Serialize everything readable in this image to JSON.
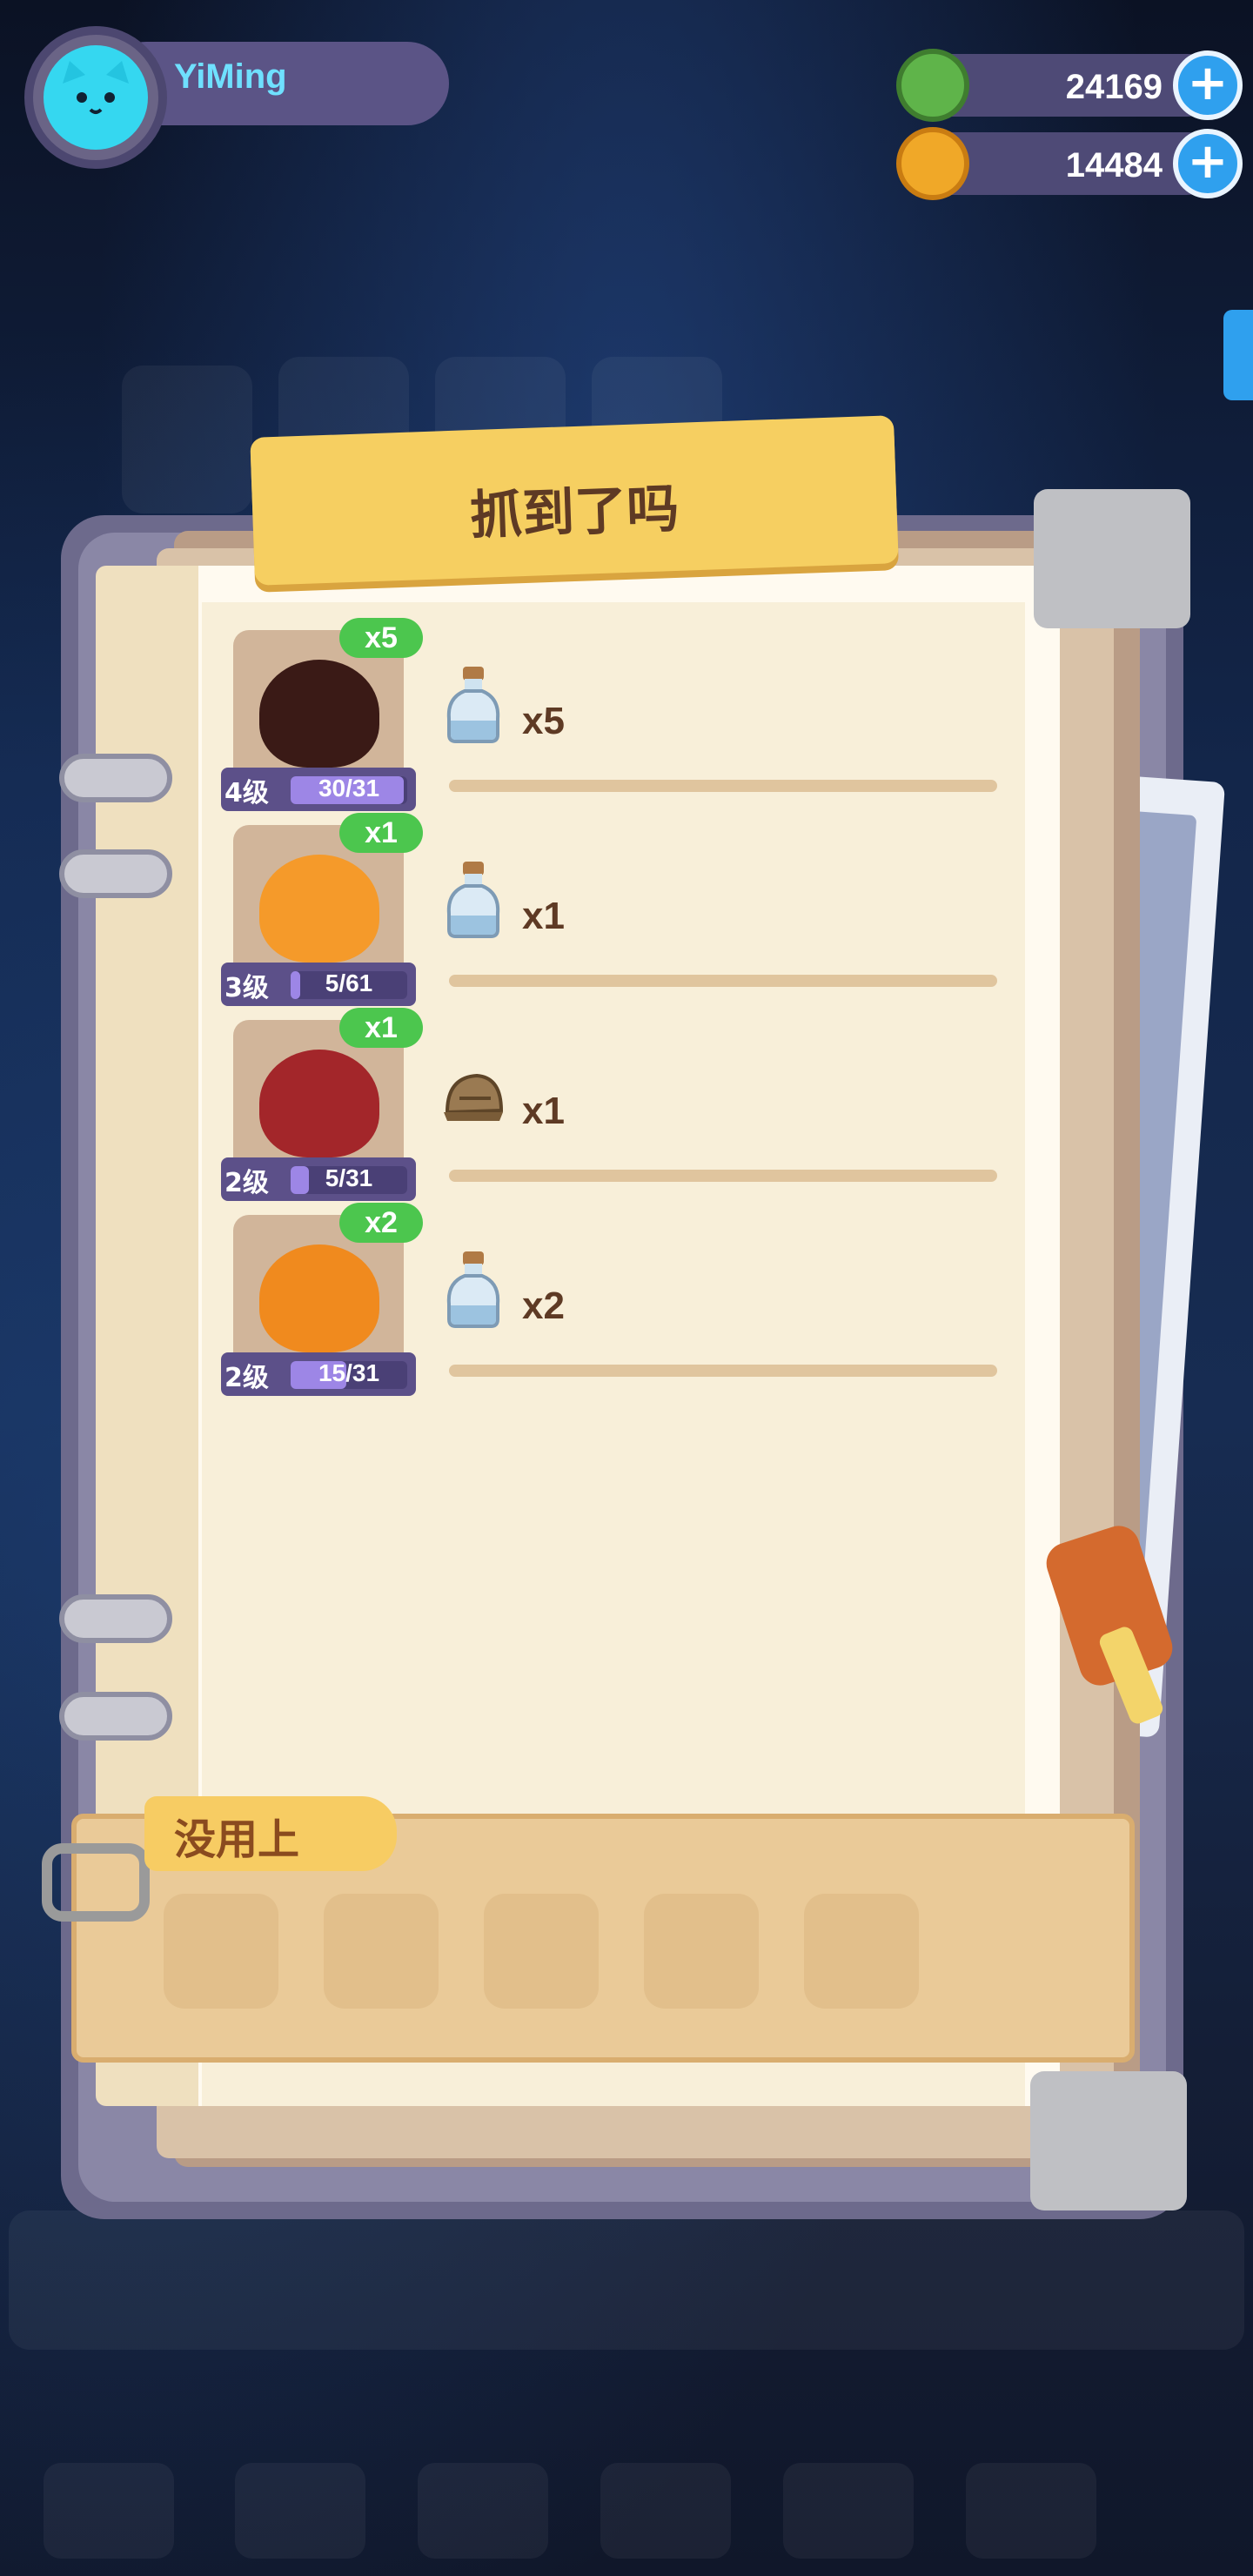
{
  "player": {
    "name": "YiMing"
  },
  "currencies": [
    {
      "name": "green-coin",
      "value": "24169",
      "color": "#5fb44a"
    },
    {
      "name": "planet-coin",
      "value": "14484",
      "color": "#f0a828"
    }
  ],
  "dialog": {
    "title": "抓到了吗",
    "catches": [
      {
        "monster_icon": "dark-lava-monster-icon",
        "monster_color": "#3a1a16",
        "count": "x5",
        "level": "4级",
        "exp": "30/31",
        "exp_fraction": 0.97,
        "drop_icon": "bottle-icon",
        "drop_count": "x5"
      },
      {
        "monster_icon": "fire-spirit-icon",
        "monster_color": "#f59a2a",
        "count": "x1",
        "level": "3级",
        "exp": "5/61",
        "exp_fraction": 0.08,
        "drop_icon": "bottle-icon",
        "drop_count": "x1"
      },
      {
        "monster_icon": "red-slime-icon",
        "monster_color": "#a3262a",
        "count": "x1",
        "level": "2级",
        "exp": "5/31",
        "exp_fraction": 0.16,
        "drop_icon": "helmet-icon",
        "drop_count": "x1"
      },
      {
        "monster_icon": "flame-hood-icon",
        "monster_color": "#f08a1e",
        "count": "x2",
        "level": "2级",
        "exp": "15/31",
        "exp_fraction": 0.48,
        "drop_icon": "bottle-icon",
        "drop_count": "x2"
      }
    ],
    "unused": {
      "title": "没用上",
      "slots": 5
    }
  }
}
